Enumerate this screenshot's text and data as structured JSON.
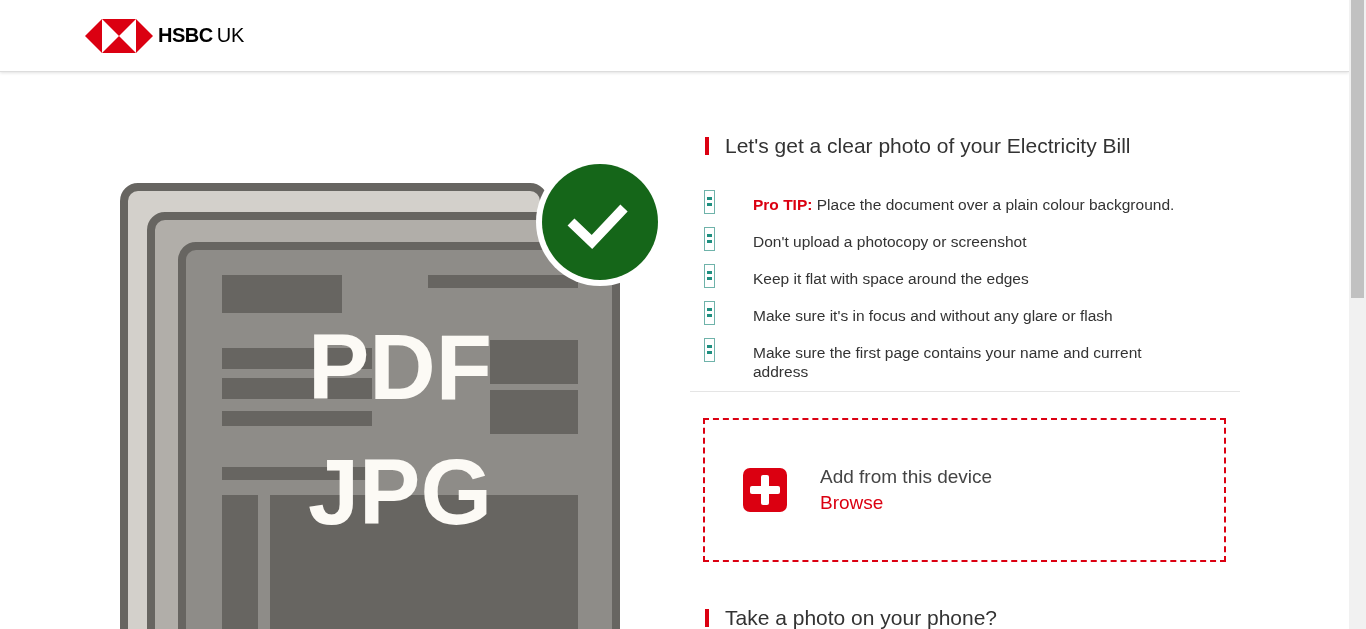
{
  "header": {
    "logo": {
      "brand": "HSBC",
      "region": "UK"
    }
  },
  "illustration": {
    "formats": [
      "PDF",
      "JPG"
    ]
  },
  "tips": {
    "heading": "Let's get a clear photo of your Electricity Bill",
    "items": [
      {
        "text": "**Pro TIP:** Place the document over a plain colour background."
      },
      {
        "text": "Don't upload a photocopy or screenshot"
      },
      {
        "text": "Keep it flat with space around the edges"
      },
      {
        "text": "Make sure it's in focus and without any glare or flash"
      },
      {
        "text": "Make sure the first page contains your name and current address"
      }
    ]
  },
  "upload": {
    "title": "Add from this device",
    "link": "Browse"
  },
  "phone_section": {
    "heading": "Take a photo on your phone?"
  }
}
